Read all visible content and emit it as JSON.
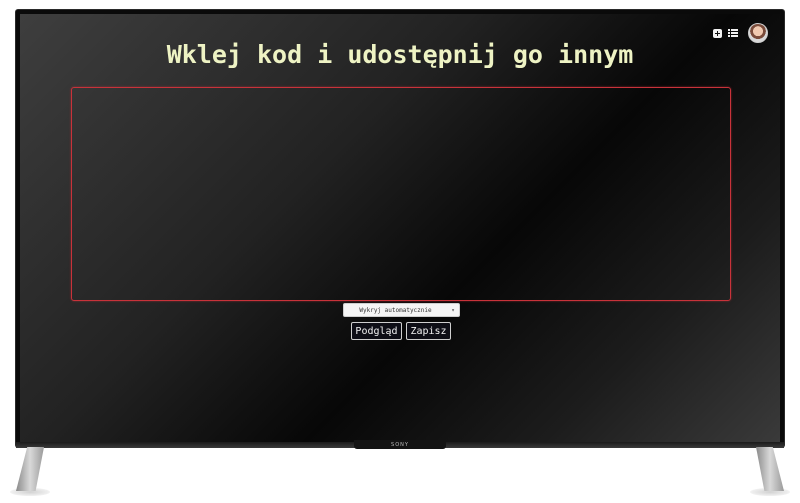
{
  "header": {
    "title": "Wklej kod i udostępnij go innym",
    "icons": {
      "add": "plus-square-icon",
      "list": "list-icon",
      "user": "user-avatar"
    }
  },
  "editor": {
    "value": "",
    "placeholder": ""
  },
  "language_select": {
    "selected": "Wykryj automatycznie",
    "chevron": "▾"
  },
  "actions": {
    "preview_label": "Podgląd",
    "save_label": "Zapisz"
  },
  "device": {
    "brand": "SONY"
  },
  "colors": {
    "title": "#eef3c4",
    "editor_border": "#c8323a",
    "button_bg": "#0e0e16"
  }
}
